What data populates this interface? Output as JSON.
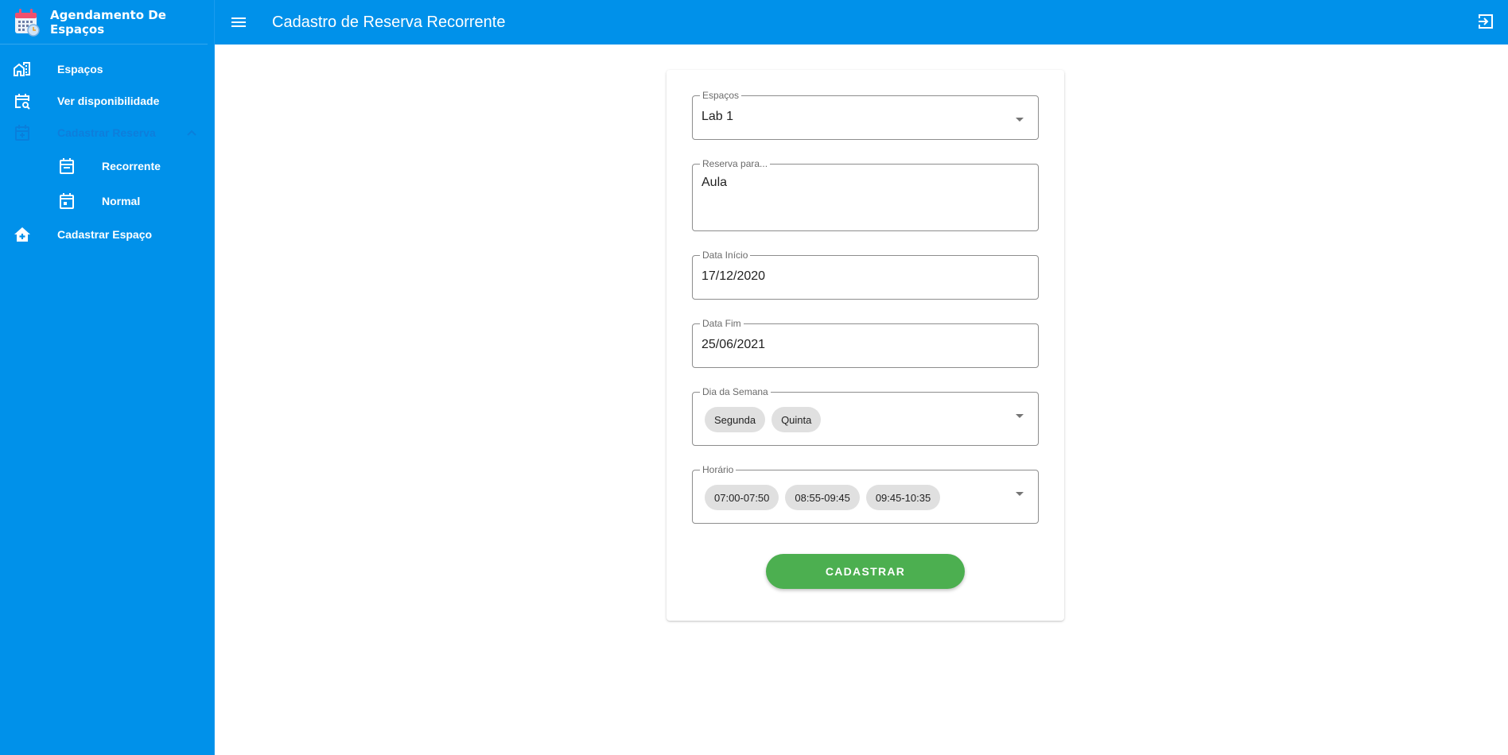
{
  "app": {
    "title": "Agendamento De Espaços"
  },
  "header": {
    "title": "Cadastro de Reserva Recorrente"
  },
  "sidebar": {
    "items": [
      {
        "label": "Espaços",
        "icon": "domain-icon"
      },
      {
        "label": "Ver disponibilidade",
        "icon": "calendar-search-icon"
      },
      {
        "label": "Cadastrar Reserva",
        "icon": "calendar-add-icon",
        "expanded": true
      },
      {
        "label": "Recorrente",
        "icon": "calendar-recurring-icon"
      },
      {
        "label": "Normal",
        "icon": "calendar-today-icon"
      },
      {
        "label": "Cadastrar Espaço",
        "icon": "add-home-icon"
      }
    ]
  },
  "form": {
    "espacos": {
      "label": "Espaços",
      "value": "Lab 1"
    },
    "reserva": {
      "label": "Reserva para...",
      "value": "Aula"
    },
    "data_inicio": {
      "label": "Data Início",
      "value": "17/12/2020"
    },
    "data_fim": {
      "label": "Data Fim",
      "value": "25/06/2021"
    },
    "dia_semana": {
      "label": "Dia da Semana",
      "chips": [
        "Segunda",
        "Quinta"
      ]
    },
    "horario": {
      "label": "Horário",
      "chips": [
        "07:00-07:50",
        "08:55-09:45",
        "09:45-10:35"
      ]
    },
    "submit_label": "CADASTRAR"
  },
  "colors": {
    "primary": "#0091ea",
    "success": "#4caf50"
  }
}
